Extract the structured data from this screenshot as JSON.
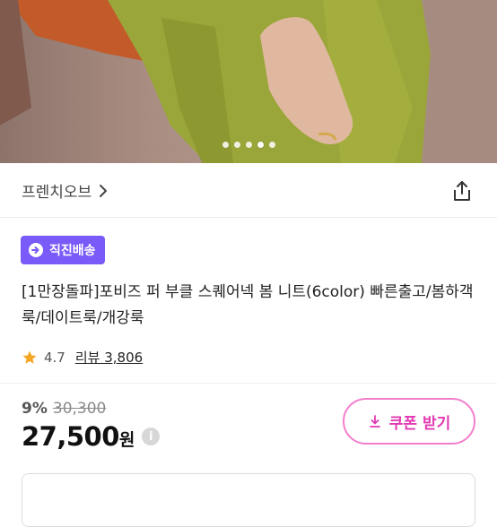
{
  "carousel": {
    "slide_count": 5,
    "active_index": 3
  },
  "seller": {
    "name": "프렌치오브"
  },
  "badge": {
    "label": "직진배송"
  },
  "product": {
    "title": "[1만장돌파]포비즈 퍼 부클 스퀘어넥 봄 니트(6color) 빠른출고/봄하객룩/데이트룩/개강룩"
  },
  "rating": {
    "score": "4.7",
    "review_label": "리뷰 3,806"
  },
  "price": {
    "discount": "9%",
    "original": "30,300",
    "final": "27,500",
    "currency": "원",
    "info_glyph": "i"
  },
  "coupon": {
    "label": "쿠폰 받기"
  },
  "colors": {
    "brand_purple": "#7a5af8",
    "coupon_pink": "#e23ab2",
    "star": "#f5a623"
  }
}
